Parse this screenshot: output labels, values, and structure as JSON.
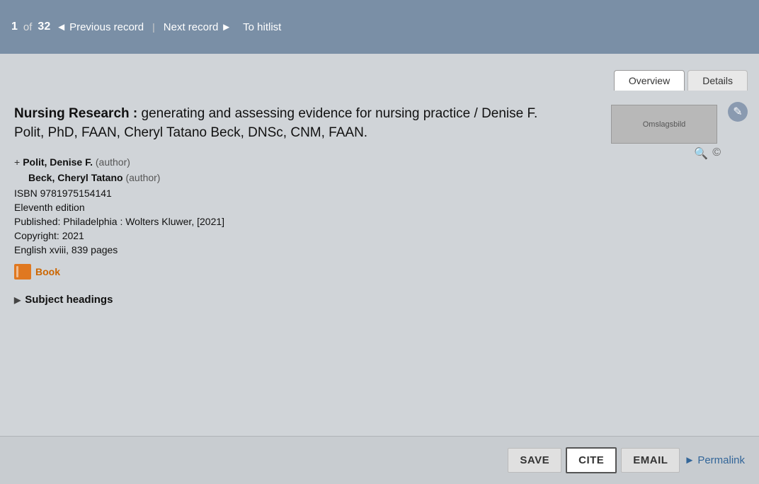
{
  "topbar": {
    "record_current": "1",
    "record_total": "32",
    "of_label": "of",
    "prev_label": "Previous record",
    "next_label": "Next record",
    "hitlist_label": "To hitlist"
  },
  "tabs": [
    {
      "id": "overview",
      "label": "Overview",
      "active": true
    },
    {
      "id": "details",
      "label": "Details",
      "active": false
    }
  ],
  "record": {
    "title_bold": "Nursing Research :",
    "title_rest": " generating and assessing evidence for nursing practice / Denise F. Polit, PhD, FAAN, Cheryl Tatano Beck, DNSc, CNM, FAAN.",
    "authors": [
      {
        "name": "Polit, Denise F.",
        "role": "(author)",
        "expandable": true
      },
      {
        "name": "Beck, Cheryl Tatano",
        "role": "(author)",
        "expandable": false
      }
    ],
    "isbn_label": "ISBN",
    "isbn": "9781975154141",
    "edition": "Eleventh edition",
    "published": "Published: Philadelphia : Wolters Kluwer, [2021]",
    "copyright": "Copyright: 2021",
    "language_pages": "English xviii, 839 pages",
    "type_label": "Book",
    "cover_alt": "Omslagsbild",
    "subject_headings_label": "Subject headings"
  },
  "actions": {
    "save_label": "SAVE",
    "cite_label": "CITE",
    "email_label": "EMAIL",
    "permalink_label": "Permalink"
  },
  "icons": {
    "edit": "✎",
    "search": "🔍",
    "copyright": "©",
    "prev_arrow": "◄",
    "next_arrow": "►",
    "triangle": "▶",
    "expand": "+"
  }
}
